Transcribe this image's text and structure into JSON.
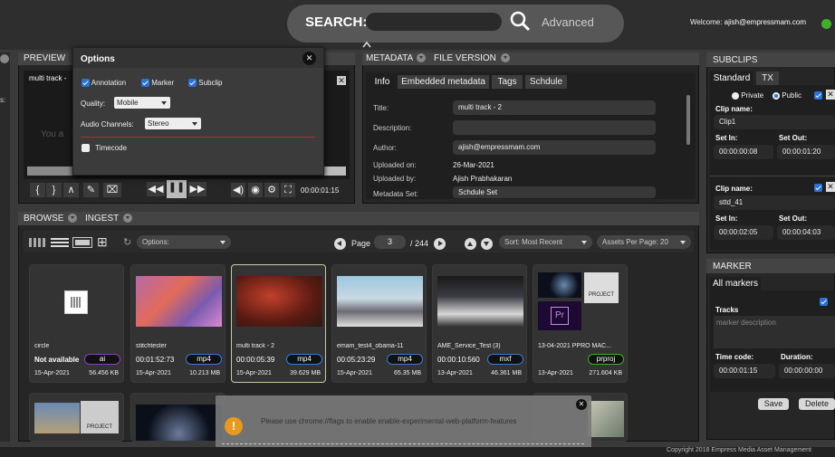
{
  "header": {
    "search_label": "SEARCH:",
    "search_placeholder": "",
    "advanced_label": "Advanced",
    "welcome_prefix": "Welcome:",
    "user_email": "ajish@empressmam.com"
  },
  "preview": {
    "tab_label": "PREVIEW",
    "track_title": "multi track -",
    "overlay_text": "You a",
    "timecode": "00:00:01:15"
  },
  "options_dialog": {
    "title": "Options",
    "annotation_label": "Annotation",
    "marker_label": "Marker",
    "subclip_label": "Subclip",
    "quality_label": "Quality:",
    "quality_value": "Mobile",
    "audio_label": "Audio Channels:",
    "audio_value": "Stereo",
    "timecode_label": "Timecode"
  },
  "metadata": {
    "tab_metadata": "METADATA",
    "tab_file_version": "FILE VERSION",
    "subtabs": [
      "Info",
      "Embedded metadata",
      "Tags",
      "Schdule"
    ],
    "title_label": "Title:",
    "title_value": "multi track - 2",
    "description_label": "Description:",
    "description_value": "",
    "author_label": "Author:",
    "author_value": "ajish@empressmam.com",
    "uploaded_on_label": "Uploaded on:",
    "uploaded_on_value": "26-Mar-2021",
    "uploaded_by_label": "Uploaded by:",
    "uploaded_by_value": "Ajish Prabhakaran",
    "metadata_set_label": "Metadata Set:",
    "metadata_set_value": "Schdule Set"
  },
  "subclips": {
    "header": "SUBCLIPS",
    "tab_standard": "Standard",
    "tab_tx": "TX",
    "private_label": "Private",
    "public_label": "Public",
    "items": [
      {
        "clip_name_label": "Clip name:",
        "clip_name": "Clip1",
        "set_in_label": "Set In:",
        "set_in": "00:00:00:08",
        "set_out_label": "Set Out:",
        "set_out": "00:00:01:20"
      },
      {
        "clip_name_label": "Clip name:",
        "clip_name": "sttd_41",
        "set_in_label": "Set In:",
        "set_in": "00:00:02:05",
        "set_out_label": "Set Out:",
        "set_out": "00:00:04:03"
      }
    ]
  },
  "marker": {
    "header": "MARKER",
    "tab_all": "All markers",
    "tracks_label": "Tracks",
    "description_placeholder": "marker description",
    "timecode_label": "Time code:",
    "timecode_value": "00:00:01:15",
    "duration_label": "Duration:",
    "duration_value": "00:00:00:00",
    "save_label": "Save",
    "delete_label": "Delete"
  },
  "browse": {
    "tab_browse": "BROWSE",
    "tab_ingest": "INGEST",
    "options_label": "Options:",
    "page_label": "Page",
    "page_value": "3",
    "page_total": "/ 244",
    "sort_label": "Sort: Most Recent",
    "per_page_label": "Assets Per Page: 20",
    "cards": [
      {
        "name": "circle",
        "duration": "Not available",
        "badge": "ai",
        "badge_color": "#8a3fbf",
        "date": "15-Apr-2021",
        "size": "56.456 KB"
      },
      {
        "name": "stitchtester",
        "duration": "00:01:52:73",
        "badge": "mp4",
        "badge_color": "#3b7bd5",
        "date": "15-Apr-2021",
        "size": "10.213 MB"
      },
      {
        "name": "multi track - 2",
        "duration": "00:00:05:39",
        "badge": "mp4",
        "badge_color": "#3b7bd5",
        "date": "15-Apr-2021",
        "size": "39.629 MB"
      },
      {
        "name": "emam_test4_obama-11",
        "duration": "00:05:23:29",
        "badge": "mp4",
        "badge_color": "#3b7bd5",
        "date": "15-Apr-2021",
        "size": "65.35 MB"
      },
      {
        "name": "AME_Service_Test (3)",
        "duration": "00:00:10:560",
        "badge": "mxf",
        "badge_color": "#3b7bd5",
        "date": "13-Apr-2021",
        "size": "46.361 MB"
      },
      {
        "name": "13-04-2021 PPRO MAC...",
        "duration": "",
        "badge": "prproj",
        "badge_color": "#3fae2a",
        "date": "13-Apr-2021",
        "size": "271.604 KB"
      }
    ],
    "project_label": "PROJECT"
  },
  "notification": {
    "text": "Please use chrome://flags to enable enable-experimental-web-platform-features"
  },
  "footer": {
    "copyright": "Copyright 2018 Empress Media Asset Management"
  }
}
